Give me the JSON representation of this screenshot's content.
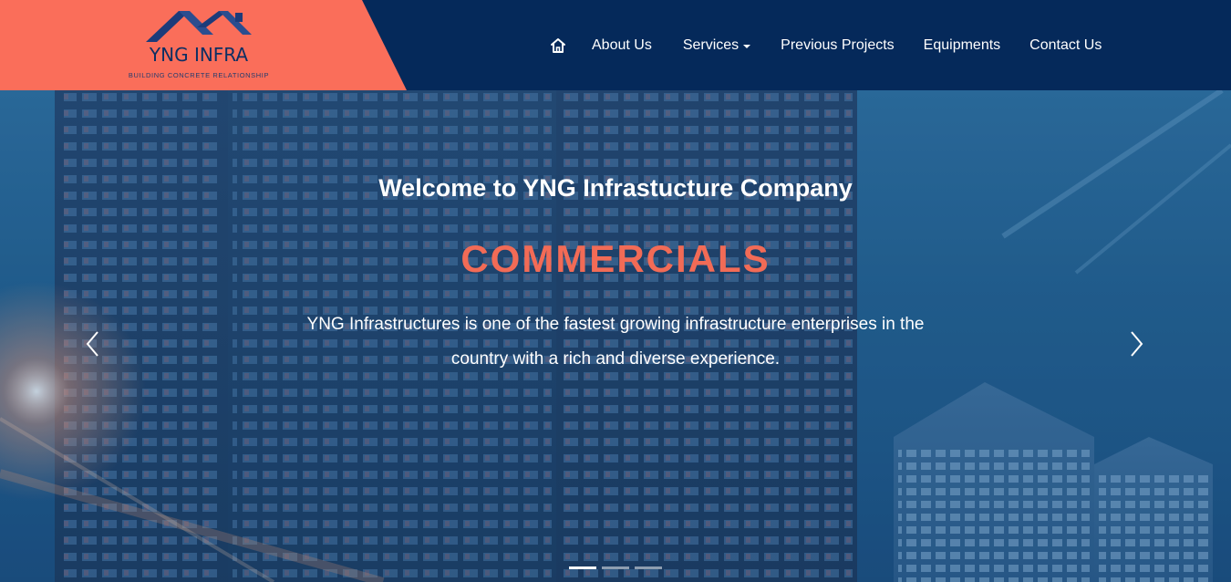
{
  "brand": {
    "name": "YNG INFRA",
    "tagline": "BUILDING CONCRETE RELATIONSHIP",
    "accent": "#fa6e5a",
    "navy": "#05295a"
  },
  "nav": {
    "home_icon": "home-icon",
    "items": [
      {
        "label": "About Us"
      },
      {
        "label": "Services"
      },
      {
        "label": "Previous Projects"
      },
      {
        "label": "Equipments"
      },
      {
        "label": "Contact Us"
      }
    ]
  },
  "hero": {
    "welcome": "Welcome to YNG Infrastucture Company",
    "title": "COMMERCIALS",
    "description": "YNG Infrastructures is one of the fastest growing infrastructure enterprises in the country with a rich and diverse experience.",
    "title_color": "#f26b56",
    "prev_icon": "chevron-left-icon",
    "next_icon": "chevron-right-icon",
    "slides_total": 3,
    "active_slide": 1
  }
}
